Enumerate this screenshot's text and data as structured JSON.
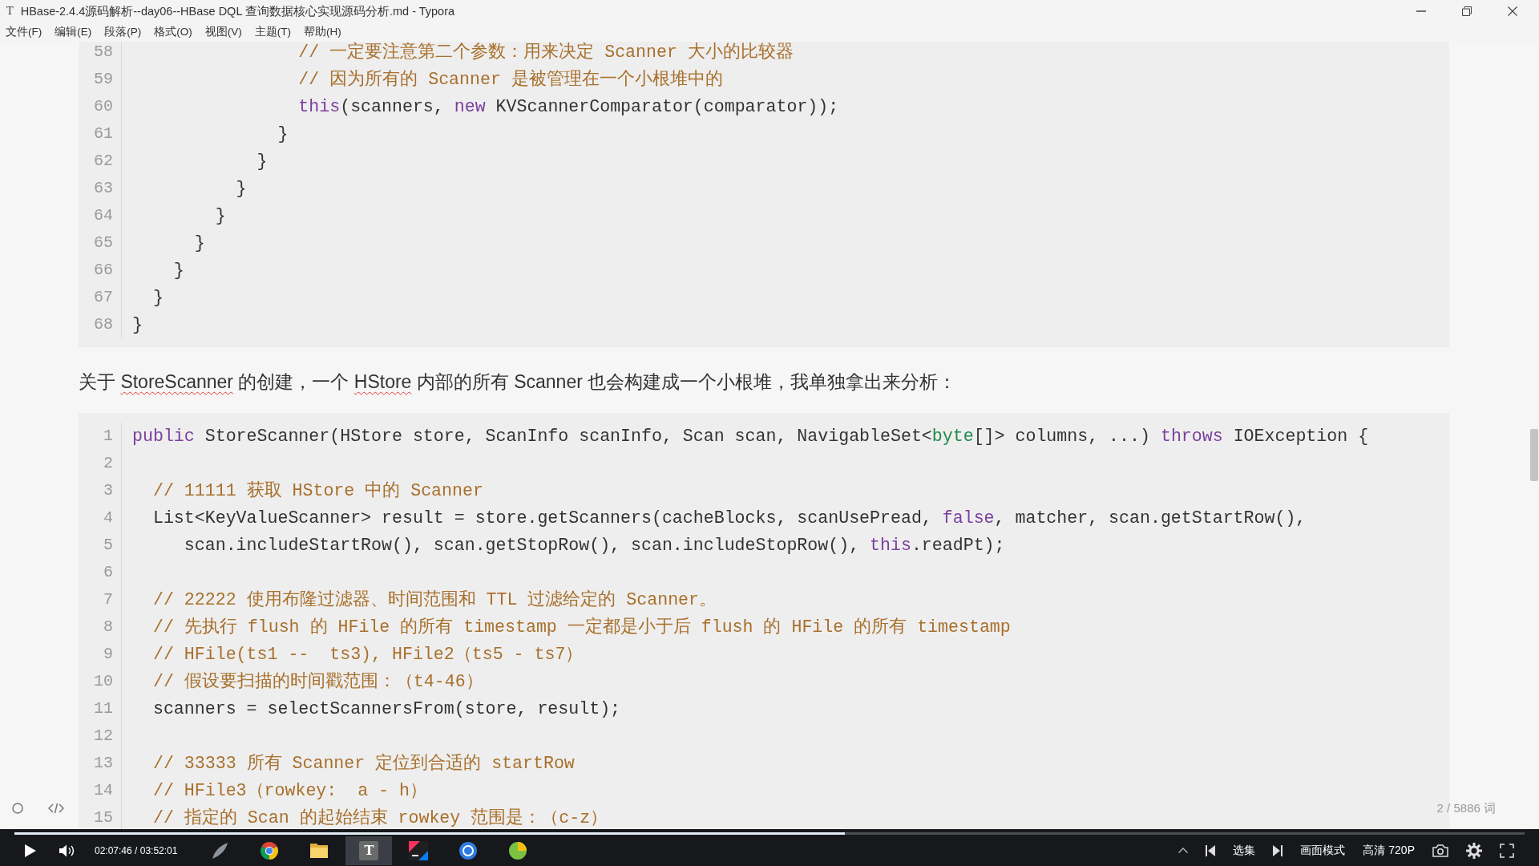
{
  "window": {
    "app_icon": "T",
    "title": "HBase-2.4.4源码解析--day06--HBase DQL 查询数据核心实现源码分析.md - Typora"
  },
  "menu": [
    "文件(F)",
    "编辑(E)",
    "段落(P)",
    "格式(O)",
    "视图(V)",
    "主题(T)",
    "帮助(H)"
  ],
  "document": {
    "blocks": [
      {
        "kind": "code",
        "lines": [
          {
            "number": "58",
            "tokens": [
              {
                "kind": "comment",
                "text": "                // 一定要注意第二个参数：用来决定 Scanner 大小的比较器"
              }
            ]
          },
          {
            "number": "59",
            "tokens": [
              {
                "kind": "comment",
                "text": "                // 因为所有的 Scanner 是被管理在一个小根堆中的"
              }
            ]
          },
          {
            "number": "60",
            "tokens": [
              {
                "kind": "keyword",
                "text": "                this"
              },
              {
                "kind": "plain",
                "text": "(scanners, "
              },
              {
                "kind": "keyword",
                "text": "new"
              },
              {
                "kind": "plain",
                "text": " KVScannerComparator(comparator));"
              }
            ]
          },
          {
            "number": "61",
            "tokens": [
              {
                "kind": "plain",
                "text": "              }"
              }
            ]
          },
          {
            "number": "62",
            "tokens": [
              {
                "kind": "plain",
                "text": "            }"
              }
            ]
          },
          {
            "number": "63",
            "tokens": [
              {
                "kind": "plain",
                "text": "          }"
              }
            ]
          },
          {
            "number": "64",
            "tokens": [
              {
                "kind": "plain",
                "text": "        }"
              }
            ]
          },
          {
            "number": "65",
            "tokens": [
              {
                "kind": "plain",
                "text": "      }"
              }
            ]
          },
          {
            "number": "66",
            "tokens": [
              {
                "kind": "plain",
                "text": "    }"
              }
            ]
          },
          {
            "number": "67",
            "tokens": [
              {
                "kind": "plain",
                "text": "  }"
              }
            ]
          },
          {
            "number": "68",
            "tokens": [
              {
                "kind": "plain",
                "text": "}"
              }
            ]
          }
        ]
      },
      {
        "kind": "paragraph",
        "segments": [
          {
            "text": "关于 ",
            "misspelled": false
          },
          {
            "text": "StoreScanner",
            "misspelled": true
          },
          {
            "text": " 的创建，一个 ",
            "misspelled": false
          },
          {
            "text": "HStore",
            "misspelled": true
          },
          {
            "text": " 内部的所有 Scanner 也会构建成一个小根堆，我单独拿出来分析：",
            "misspelled": false
          }
        ]
      },
      {
        "kind": "code",
        "lines": [
          {
            "number": "1",
            "tokens": [
              {
                "kind": "keyword",
                "text": "public"
              },
              {
                "kind": "plain",
                "text": " StoreScanner(HStore store, ScanInfo scanInfo, Scan scan, NavigableSet<"
              },
              {
                "kind": "type",
                "text": "byte"
              },
              {
                "kind": "plain",
                "text": "[]> columns, ...) "
              },
              {
                "kind": "keyword",
                "text": "throws"
              },
              {
                "kind": "plain",
                "text": " IOException {"
              }
            ]
          },
          {
            "number": "2"
          },
          {
            "number": "3",
            "tokens": [
              {
                "kind": "comment",
                "text": "  // 11111 获取 HStore 中的 Scanner"
              }
            ]
          },
          {
            "number": "4",
            "tokens": [
              {
                "kind": "plain",
                "text": "  List<KeyValueScanner> result = store.getScanners(cacheBlocks, scanUsePread, "
              },
              {
                "kind": "keyword",
                "text": "false"
              },
              {
                "kind": "plain",
                "text": ", matcher, scan.getStartRow(),"
              }
            ]
          },
          {
            "number": "5",
            "tokens": [
              {
                "kind": "plain",
                "text": "     scan.includeStartRow(), scan.getStopRow(), scan.includeStopRow(), "
              },
              {
                "kind": "keyword",
                "text": "this"
              },
              {
                "kind": "plain",
                "text": ".readPt);"
              }
            ]
          },
          {
            "number": "6"
          },
          {
            "number": "7",
            "tokens": [
              {
                "kind": "comment",
                "text": "  // 22222 使用布隆过滤器、时间范围和 TTL 过滤给定的 Scanner。"
              }
            ]
          },
          {
            "number": "8",
            "tokens": [
              {
                "kind": "comment",
                "text": "  // 先执行 flush 的 HFile 的所有 timestamp 一定都是小于后 flush 的 HFile 的所有 timestamp"
              }
            ]
          },
          {
            "number": "9",
            "tokens": [
              {
                "kind": "comment",
                "text": "  // HFile(ts1 --  ts3), HFile2（ts5 - ts7）"
              }
            ]
          },
          {
            "number": "10",
            "tokens": [
              {
                "kind": "comment",
                "text": "  // 假设要扫描的时间戳范围：（t4-46）"
              }
            ]
          },
          {
            "number": "11",
            "tokens": [
              {
                "kind": "plain",
                "text": "  scanners = selectScannersFrom(store, result);"
              }
            ]
          },
          {
            "number": "12"
          },
          {
            "number": "13",
            "tokens": [
              {
                "kind": "comment",
                "text": "  // 33333 所有 Scanner 定位到合适的 startRow"
              }
            ]
          },
          {
            "number": "14",
            "tokens": [
              {
                "kind": "comment",
                "text": "  // HFile3（rowkey:  a - h）"
              }
            ]
          },
          {
            "number": "15",
            "tokens": [
              {
                "kind": "comment",
                "text": "  // 指定的 Scan 的起始结束 rowkey 范围是：（c-z）"
              }
            ]
          }
        ]
      }
    ]
  },
  "status_bar": {
    "word_count": "2 / 5886 词"
  },
  "video_player": {
    "playing": false,
    "level": 0.55,
    "time": "02:07:46 / 03:52:01",
    "episodes_button": "选集",
    "picture_mode_button": "画面模式",
    "quality_button": "高清 720P"
  },
  "taskbar": {
    "apps": [
      {
        "kind": "feather",
        "selected": false
      },
      {
        "kind": "wheel",
        "selected": false
      },
      {
        "kind": "folder",
        "selected": false
      },
      {
        "kind": "letter",
        "label": "T",
        "selected": true
      },
      {
        "kind": "tile",
        "selected": false
      },
      {
        "kind": "ring",
        "selected": false
      },
      {
        "kind": "ball",
        "selected": false
      }
    ]
  }
}
